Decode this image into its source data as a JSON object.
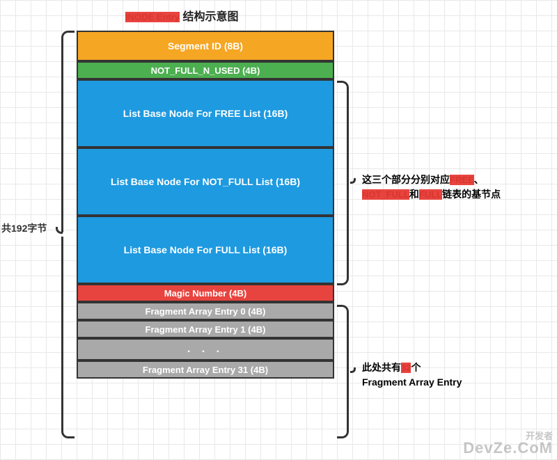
{
  "title": {
    "red": "INODE Entry",
    "rest": " 结构示意图"
  },
  "left_label": "共192字节",
  "cells": {
    "segment_id": "Segment ID (8B)",
    "not_full_n_used": "NOT_FULL_N_USED (4B)",
    "list_free": "List Base Node For FREE List (16B)",
    "list_notfull": "List Base Node For NOT_FULL List (16B)",
    "list_full": "List Base Node For FULL List (16B)",
    "magic": "Magic Number (4B)",
    "frag0": "Fragment Array Entry 0 (4B)",
    "frag1": "Fragment Array Entry 1 (4B)",
    "dots": ". . .",
    "frag31": "Fragment Array Entry 31 (4B)"
  },
  "anno1": {
    "p1": "这三个部分分别对应",
    "r1": "FREE",
    "p2": "、",
    "r2": "NOT_FULL",
    "p3": "和",
    "r3": "FULL",
    "p4": "链表的基节点"
  },
  "anno2": {
    "p1": "此处共有",
    "r1": "32",
    "p2": "个",
    "p3": "Fragment Array Entry"
  },
  "watermark": {
    "l1": "开发者",
    "l2": "DevZe.CoM"
  }
}
